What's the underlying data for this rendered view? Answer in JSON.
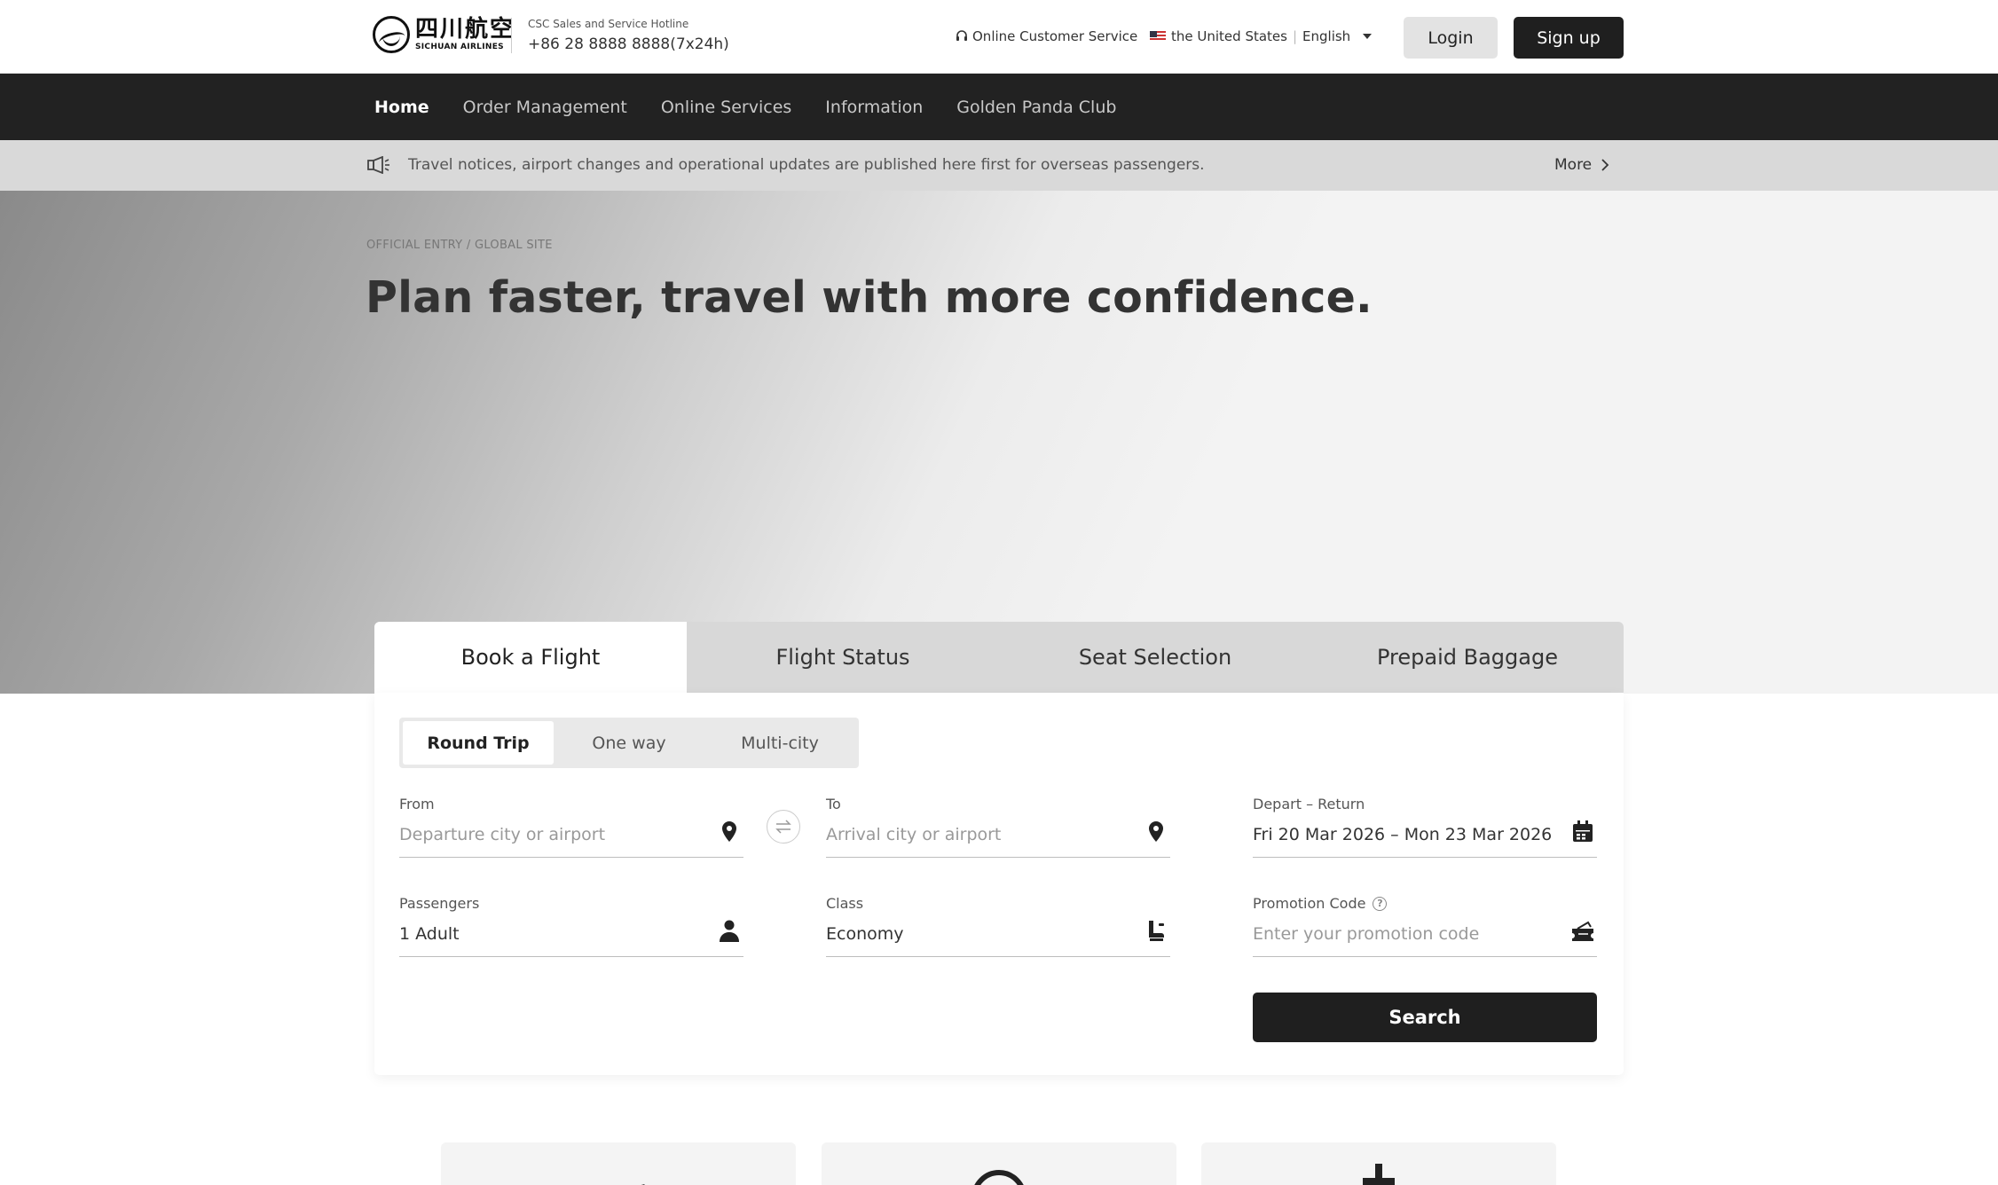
{
  "header": {
    "logo_cn": "四川航空",
    "logo_en": "SICHUAN AIRLINES",
    "hotline_label": "CSC Sales and Service Hotline",
    "hotline_number": "+86 28 8888 8888(7x24h)",
    "customer_service": "Online Customer Service",
    "country": "the United States",
    "language": "English",
    "login_label": "Login",
    "signup_label": "Sign up"
  },
  "nav": {
    "items": [
      {
        "label": "Home",
        "active": true
      },
      {
        "label": "Order Management",
        "active": false
      },
      {
        "label": "Online Services",
        "active": false
      },
      {
        "label": "Information",
        "active": false
      },
      {
        "label": "Golden Panda Club",
        "active": false
      }
    ]
  },
  "notice": {
    "text": "Travel notices, airport changes and operational updates are published here first for overseas passengers.",
    "more_label": "More"
  },
  "hero": {
    "kicker": "OFFICIAL ENTRY / GLOBAL SITE",
    "title": "Plan faster, travel with more confidence."
  },
  "booking": {
    "tabs": [
      {
        "label": "Book a Flight",
        "active": true
      },
      {
        "label": "Flight Status",
        "active": false
      },
      {
        "label": "Seat Selection",
        "active": false
      },
      {
        "label": "Prepaid Baggage",
        "active": false
      }
    ],
    "trip_types": [
      {
        "label": "Round Trip",
        "active": true
      },
      {
        "label": "One way",
        "active": false
      },
      {
        "label": "Multi-city",
        "active": false
      }
    ],
    "from": {
      "label": "From",
      "placeholder": "Departure city or airport",
      "value": ""
    },
    "to": {
      "label": "To",
      "placeholder": "Arrival city or airport",
      "value": ""
    },
    "dates": {
      "label": "Depart – Return",
      "value": "Fri 20 Mar 2026 – Mon 23 Mar 2026"
    },
    "passengers": {
      "label": "Passengers",
      "value": "1 Adult"
    },
    "cabin": {
      "label": "Class",
      "value": "Economy"
    },
    "promo": {
      "label": "Promotion Code",
      "placeholder": "Enter your promotion code",
      "value": ""
    },
    "search_label": "Search"
  },
  "icons": {
    "service": "headset-icon",
    "notice": "megaphone-icon",
    "from": "location-pin-icon",
    "to": "location-pin-icon",
    "swap": "swap-arrows-icon",
    "dates": "calendar-icon",
    "passengers": "person-icon",
    "cabin": "seat-icon",
    "promo": "ticket-icon"
  },
  "colors": {
    "dark": "#1f1f1f",
    "nav_bg": "#222222",
    "notice_bg": "#d9d9d9",
    "tab_bg": "#d8d8d8"
  }
}
